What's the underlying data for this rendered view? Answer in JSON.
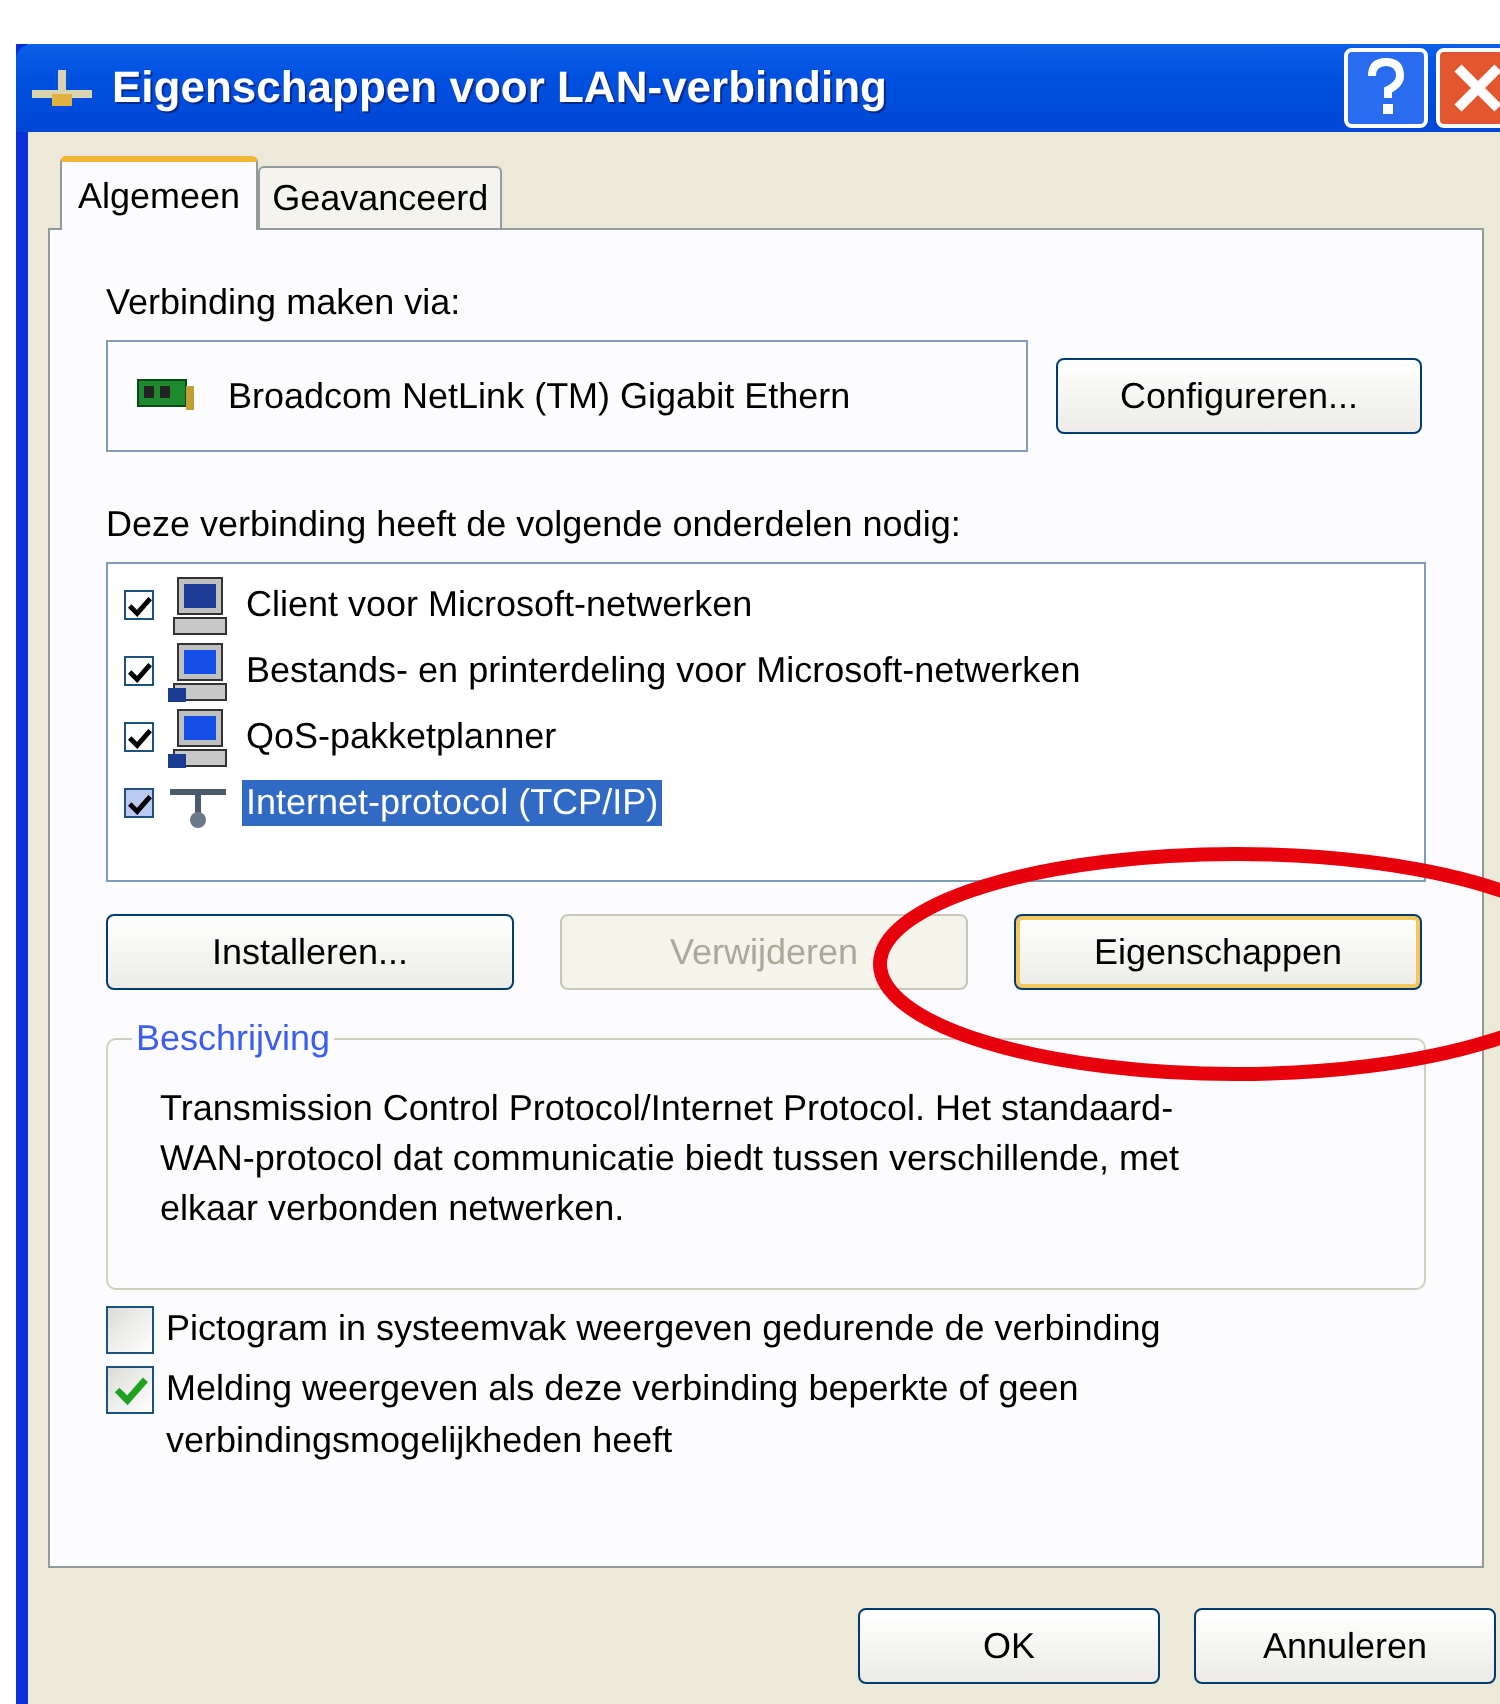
{
  "window": {
    "title": "Eigenschappen voor LAN-verbinding"
  },
  "tabs": [
    {
      "label": "Algemeen",
      "selected": true
    },
    {
      "label": "Geavanceerd",
      "selected": false
    }
  ],
  "connect_via": {
    "label": "Verbinding maken via:",
    "adapter": "Broadcom NetLink (TM) Gigabit Ethern",
    "button": "Configureren..."
  },
  "components": {
    "label": "Deze verbinding heeft de volgende onderdelen nodig:",
    "items": [
      {
        "label": "Client voor Microsoft-netwerken",
        "kind": "client",
        "checked": true,
        "selected": false
      },
      {
        "label": "Bestands- en printerdeling voor Microsoft-netwerken",
        "kind": "service",
        "checked": true,
        "selected": false
      },
      {
        "label": "QoS-pakketplanner",
        "kind": "service",
        "checked": true,
        "selected": false
      },
      {
        "label": "Internet-protocol (TCP/IP)",
        "kind": "protocol",
        "checked": true,
        "selected": true
      }
    ]
  },
  "component_buttons": [
    {
      "label": "Installeren...",
      "disabled": false,
      "default": false
    },
    {
      "label": "Verwijderen",
      "disabled": true,
      "default": false
    },
    {
      "label": "Eigenschappen",
      "disabled": false,
      "default": true
    }
  ],
  "description": {
    "title": "Beschrijving",
    "text": "Transmission Control Protocol/Internet Protocol. Het standaard-WAN-protocol dat communicatie biedt tussen verschillende, met elkaar verbonden netwerken."
  },
  "options": [
    {
      "label": "Pictogram in systeemvak weergeven gedurende de verbinding",
      "checked": false
    },
    {
      "label": "Melding weergeven als deze verbinding beperkte of geen verbindingsmogelijkheden heeft",
      "checked": true
    }
  ],
  "dialog_buttons": [
    "OK",
    "Annuleren"
  ]
}
